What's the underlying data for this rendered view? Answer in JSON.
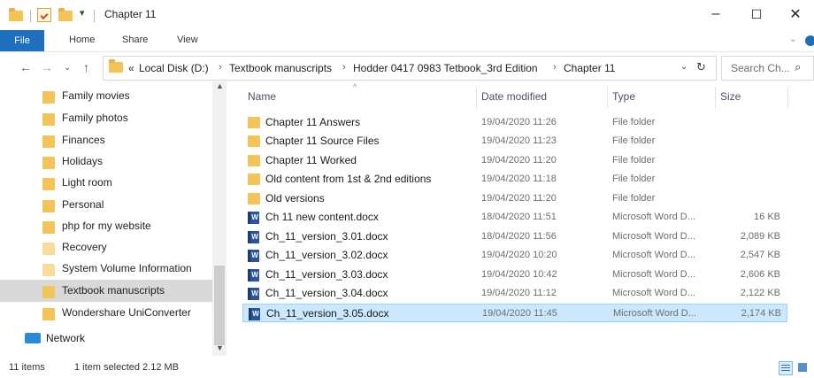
{
  "window": {
    "title": "Chapter 11",
    "minimize": "–",
    "maximize": "☐",
    "close": "✕"
  },
  "ribbon": {
    "tabs": [
      "File",
      "Home",
      "Share",
      "View"
    ]
  },
  "address": {
    "prefix": "«",
    "breadcrumbs": [
      "Local Disk (D:)",
      "Textbook manuscripts",
      "Hodder 0417 0983 Tetbook_3rd Edition",
      "Chapter 11"
    ],
    "separator": "›"
  },
  "search": {
    "placeholder": "Search Ch..."
  },
  "nav_pane": {
    "items": [
      {
        "label": "Family movies"
      },
      {
        "label": "Family photos"
      },
      {
        "label": "Finances"
      },
      {
        "label": "Holidays"
      },
      {
        "label": "Light room"
      },
      {
        "label": "Personal"
      },
      {
        "label": "php for my website"
      },
      {
        "label": "Recovery"
      },
      {
        "label": "System Volume Information"
      },
      {
        "label": "Textbook manuscripts"
      },
      {
        "label": "Wondershare UniConverter"
      }
    ],
    "selected_index": 9,
    "network_label": "Network"
  },
  "columns": {
    "name": "Name",
    "date": "Date modified",
    "type": "Type",
    "size": "Size"
  },
  "files": [
    {
      "name": "Chapter 11 Answers",
      "date": "19/04/2020 11:26",
      "type": "File folder",
      "size": "",
      "icon": "folder-icon"
    },
    {
      "name": "Chapter 11 Source Files",
      "date": "19/04/2020 11:23",
      "type": "File folder",
      "size": "",
      "icon": "folder-icon"
    },
    {
      "name": "Chapter 11 Worked",
      "date": "19/04/2020 11:20",
      "type": "File folder",
      "size": "",
      "icon": "folder-icon"
    },
    {
      "name": "Old content from 1st & 2nd editions",
      "date": "19/04/2020 11:18",
      "type": "File folder",
      "size": "",
      "icon": "folder-icon"
    },
    {
      "name": "Old versions",
      "date": "19/04/2020 11:20",
      "type": "File folder",
      "size": "",
      "icon": "folder-icon"
    },
    {
      "name": "Ch 11 new content.docx",
      "date": "18/04/2020 11:51",
      "type": "Microsoft Word D...",
      "size": "16 KB",
      "icon": "word-doc-icon"
    },
    {
      "name": "Ch_11_version_3.01.docx",
      "date": "18/04/2020 11:56",
      "type": "Microsoft Word D...",
      "size": "2,089 KB",
      "icon": "word-doc-icon"
    },
    {
      "name": "Ch_11_version_3.02.docx",
      "date": "19/04/2020 10:20",
      "type": "Microsoft Word D...",
      "size": "2,547 KB",
      "icon": "word-doc-icon"
    },
    {
      "name": "Ch_11_version_3.03.docx",
      "date": "19/04/2020 10:42",
      "type": "Microsoft Word D...",
      "size": "2,606 KB",
      "icon": "word-doc-icon"
    },
    {
      "name": "Ch_11_version_3.04.docx",
      "date": "19/04/2020 11:12",
      "type": "Microsoft Word D...",
      "size": "2,122 KB",
      "icon": "word-doc-icon"
    },
    {
      "name": "Ch_11_version_3.05.docx",
      "date": "19/04/2020 11:45",
      "type": "Microsoft Word D...",
      "size": "2,174 KB",
      "icon": "word-doc-icon"
    }
  ],
  "selected_file_index": 10,
  "status": {
    "item_count": "11 items",
    "selection": "1 item selected  2.12 MB"
  },
  "colors": {
    "accent": "#1e6fbd",
    "selection_bg": "#cce8ff",
    "folder": "#f2c45a",
    "word": "#2b579a"
  }
}
